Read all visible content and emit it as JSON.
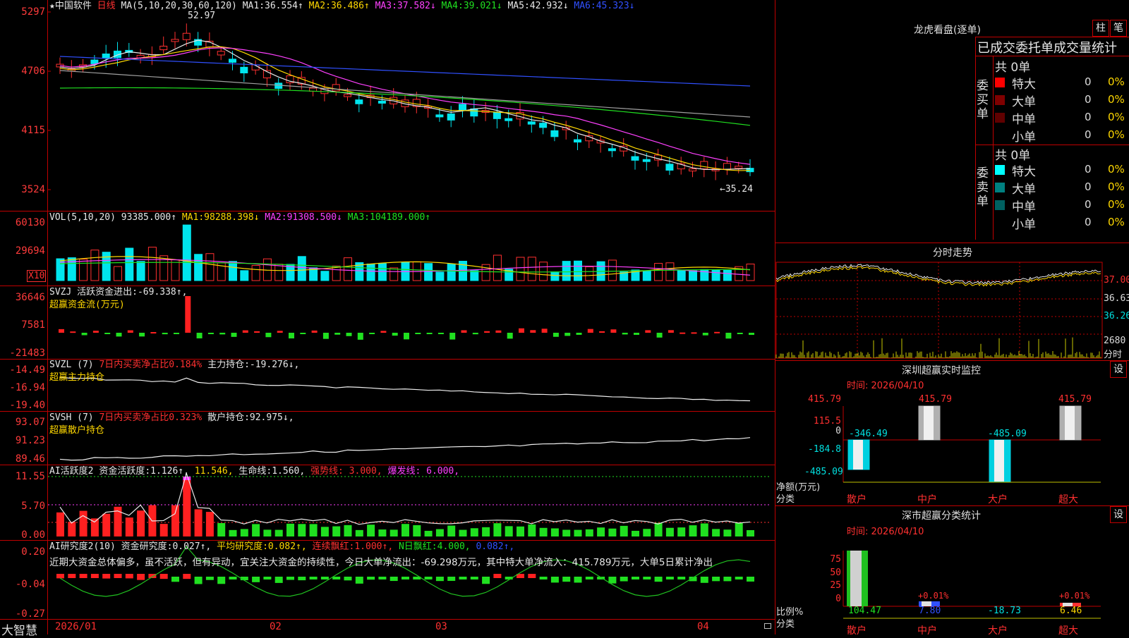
{
  "stock": {
    "star": "★",
    "name": "中国软件",
    "period": "日线"
  },
  "main_panel": {
    "ma_label": "MA(5,10,20,30,60,120)",
    "ma": [
      {
        "label": "MA1:",
        "value": "36.554↑",
        "color": "#e8e8e8"
      },
      {
        "label": "MA2:",
        "value": "36.486↑",
        "color": "#ffd800"
      },
      {
        "label": "MA3:",
        "value": "37.582↓",
        "color": "#ff40ff"
      },
      {
        "label": "MA4:",
        "value": "39.021↓",
        "color": "#20e020"
      },
      {
        "label": "MA5:",
        "value": "42.932↓",
        "color": "#a0a0a0"
      },
      {
        "label": "MA6:",
        "value": "45.323↓",
        "color": "#3050ff"
      }
    ],
    "y_ticks": [
      "5297",
      "4706",
      "4115",
      "3524"
    ],
    "high_label": "52.97",
    "low_label": "←35.24"
  },
  "vol_panel": {
    "label": "VOL(5,10,20)",
    "value": "93385.000↑",
    "ma": [
      {
        "label": "MA1:",
        "value": "98288.398↓",
        "color": "#ffd800"
      },
      {
        "label": "MA2:",
        "value": "91308.500↓",
        "color": "#ff40ff"
      },
      {
        "label": "MA3:",
        "value": "104189.000↑",
        "color": "#20e020"
      }
    ],
    "y_ticks": [
      "60130",
      "29694"
    ],
    "multiplier": "X10"
  },
  "svzj_panel": {
    "label": "SVZJ",
    "text": "活跃资金进出:",
    "value": "-69.338↑,",
    "subtitle": "超赢资金流(万元)",
    "y_ticks": [
      "36646",
      "7581",
      "-21483"
    ]
  },
  "svzl_panel": {
    "label": "SVZL (7)",
    "text1": "7日内买卖净占比0.184%",
    "text2": "主力持仓:",
    "value": "-19.276↓,",
    "subtitle": "超赢主力持仓",
    "y_ticks": [
      "-14.49",
      "-16.94",
      "-19.40"
    ]
  },
  "svsh_panel": {
    "label": "SVSH (7)",
    "text1": "7日内买卖净占比0.323%",
    "text2": "散户持仓:",
    "value": "92.975↓,",
    "subtitle": "超赢散户持仓",
    "y_ticks": [
      "93.07",
      "91.23",
      "89.46"
    ]
  },
  "ai_active_panel": {
    "label": "AI活跃度2",
    "text": "资金活跃度:",
    "v1": "1.126↑,",
    "v2": "11.546,",
    "life_label": "生命线:",
    "life_value": "1.560,",
    "strong": "强势线: 3.000,",
    "burst": "爆发线: 6.000,",
    "y_ticks": [
      "11.55",
      "5.70",
      "0.00"
    ]
  },
  "ai_research_panel": {
    "label": "AI研究度2(10)",
    "t1": "资金研究度:",
    "v1": "0.027↑,",
    "t2": "平均研究度:",
    "v2": "0.082↑,",
    "t3": "连续飘红:",
    "v3": "1.000↑,",
    "t4": "N日飘红:",
    "v4": "4.000,",
    "v5": "0.082↑,",
    "comment": "近期大资金总体偏多，虽不活跃，但有异动，宜关注大资金的持续性，今日大单净流出：-69.298万元，其中特大单净流入：415.789万元，大单5日累计净出",
    "y_ticks": [
      "0.20",
      "-0.04",
      "-0.27"
    ]
  },
  "x_axis": {
    "labels": [
      "2026/01",
      "02",
      "03",
      "04"
    ]
  },
  "bottom_left": {
    "brand": "大智慧"
  },
  "dragon_tiger": {
    "title": "龙虎看盘(逐单)",
    "btn1": "柱",
    "btn2": "笔",
    "subtitle": "已成交委托单成交量统计",
    "buy": {
      "side": "委买单",
      "total": "共 0单",
      "rows": [
        {
          "name": "特大",
          "count": "0",
          "pct": "0%",
          "color": "#ff0000"
        },
        {
          "name": "大单",
          "count": "0",
          "pct": "0%",
          "color": "#800000"
        },
        {
          "name": "中单",
          "count": "0",
          "pct": "0%",
          "color": "#600000"
        },
        {
          "name": "小单",
          "count": "0",
          "pct": "0%",
          "color": "#000000"
        }
      ]
    },
    "sell": {
      "side": "委卖单",
      "total": "共 0单",
      "rows": [
        {
          "name": "特大",
          "count": "0",
          "pct": "0%",
          "color": "#00ffff"
        },
        {
          "name": "大单",
          "count": "0",
          "pct": "0%",
          "color": "#008080"
        },
        {
          "name": "中单",
          "count": "0",
          "pct": "0%",
          "color": "#006060"
        },
        {
          "name": "小单",
          "count": "0",
          "pct": "0%",
          "color": "#000000"
        }
      ]
    }
  },
  "intraday": {
    "title": "分时走势",
    "prices": [
      "37.00",
      "36.63",
      "36.26"
    ],
    "vol": "2680",
    "unit": "分时"
  },
  "sz_monitor": {
    "title": "深圳超赢实时监控",
    "btn": "设",
    "time": "时间: 2026/04/10",
    "y_ticks": [
      "415.79",
      "115.5",
      "0",
      "-184.8",
      "-485.09"
    ],
    "bars": [
      {
        "cat": "散户",
        "value": "-346.49"
      },
      {
        "cat": "中户",
        "value": "415.79"
      },
      {
        "cat": "大户",
        "value": "-485.09"
      },
      {
        "cat": "超大",
        "value": "415.79"
      }
    ],
    "label_net": "净额(万元)",
    "label_cat": "分类"
  },
  "sz_class": {
    "title": "深市超赢分类统计",
    "btn": "设",
    "time": "时间: 2026/04/10",
    "y_ticks": [
      "75",
      "50",
      "25",
      "0"
    ],
    "bars": [
      {
        "cat": "散户",
        "value": "104.47",
        "pct": ""
      },
      {
        "cat": "中户",
        "value": "7.80",
        "pct": "+0.01%"
      },
      {
        "cat": "大户",
        "value": "-18.73",
        "pct": ""
      },
      {
        "cat": "超大",
        "value": "6.46",
        "pct": "+0.01%"
      }
    ],
    "label_ratio": "比例%",
    "label_cat": "分类"
  }
}
